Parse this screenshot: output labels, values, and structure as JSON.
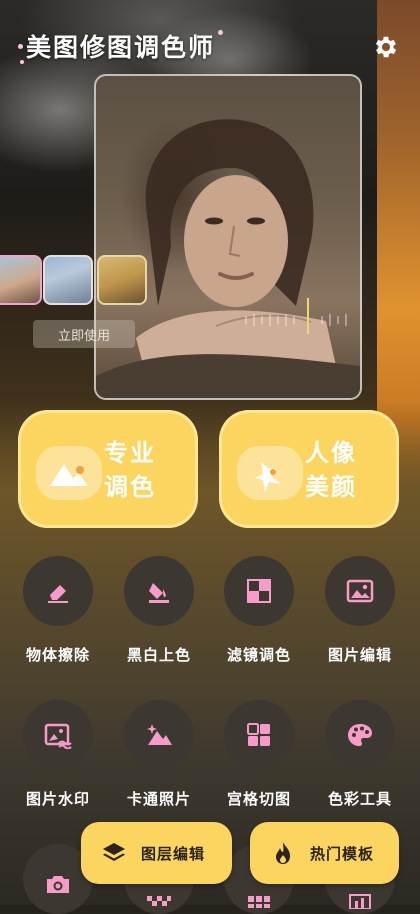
{
  "app": {
    "title": "美图修图调色师"
  },
  "icons": {
    "settings": "gear-icon"
  },
  "preview": {
    "action_label": "立即使用"
  },
  "feature_buttons": [
    {
      "label_line1": "专业",
      "label_line2": "调色",
      "icon": "mountain-icon"
    },
    {
      "label_line1": "人像",
      "label_line2": "美颜",
      "icon": "beauty-icon"
    }
  ],
  "tools": [
    {
      "label": "物体擦除",
      "icon": "eraser-icon"
    },
    {
      "label": "黑白上色",
      "icon": "paint-bucket-icon"
    },
    {
      "label": "滤镜调色",
      "icon": "checker-icon"
    },
    {
      "label": "图片编辑",
      "icon": "image-icon"
    },
    {
      "label": "图片水印",
      "icon": "image-watermark-icon"
    },
    {
      "label": "卡通照片",
      "icon": "sparkle-mountain-icon"
    },
    {
      "label": "宫格切图",
      "icon": "grid-icon"
    },
    {
      "label": "色彩工具",
      "icon": "palette-icon"
    }
  ],
  "bottom_bar": {
    "left_label": "图层编辑",
    "right_label": "热门模板"
  },
  "colors": {
    "accent_yellow": "#fbd560",
    "icon_pink": "#f79bc9",
    "tool_circle": "#3c3730"
  }
}
